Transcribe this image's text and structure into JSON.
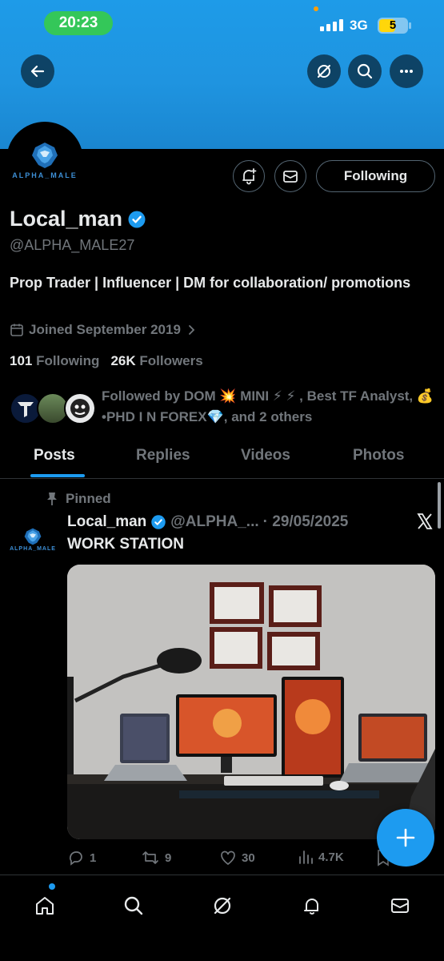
{
  "status_bar": {
    "time": "20:23",
    "network": "3G",
    "battery": "5"
  },
  "profile": {
    "avatar_label": "ALPHA_MALE",
    "name": "Local_man",
    "handle": "@ALPHA_MALE27",
    "bio": "Prop Trader | Influencer | DM for collaboration/ promotions",
    "joined": "Joined September 2019",
    "following_count": "101",
    "following_label": "Following",
    "followers_count": "26K",
    "followers_label": "Followers",
    "followed_by": "Followed by DOM 💥 MINI ⚡ ⚡ , Best TF Analyst, 💰 •PHD I N FOREX💎, and 2 others",
    "follow_button": "Following"
  },
  "tabs": [
    {
      "label": "Posts",
      "active": true
    },
    {
      "label": "Replies",
      "active": false
    },
    {
      "label": "Videos",
      "active": false
    },
    {
      "label": "Photos",
      "active": false
    }
  ],
  "post": {
    "pinned_label": "Pinned",
    "author": "Local_man",
    "handle": "@ALPHA_...",
    "date": "· 29/05/2025",
    "text": "WORK STATION",
    "avatar_label": "ALPHA_MALE",
    "replies": "1",
    "reposts": "9",
    "likes": "30",
    "views": "4.7K"
  },
  "colors": {
    "accent": "#1d9bf0",
    "banner": "#1e9be8",
    "muted": "#71767b",
    "background": "#000000"
  }
}
